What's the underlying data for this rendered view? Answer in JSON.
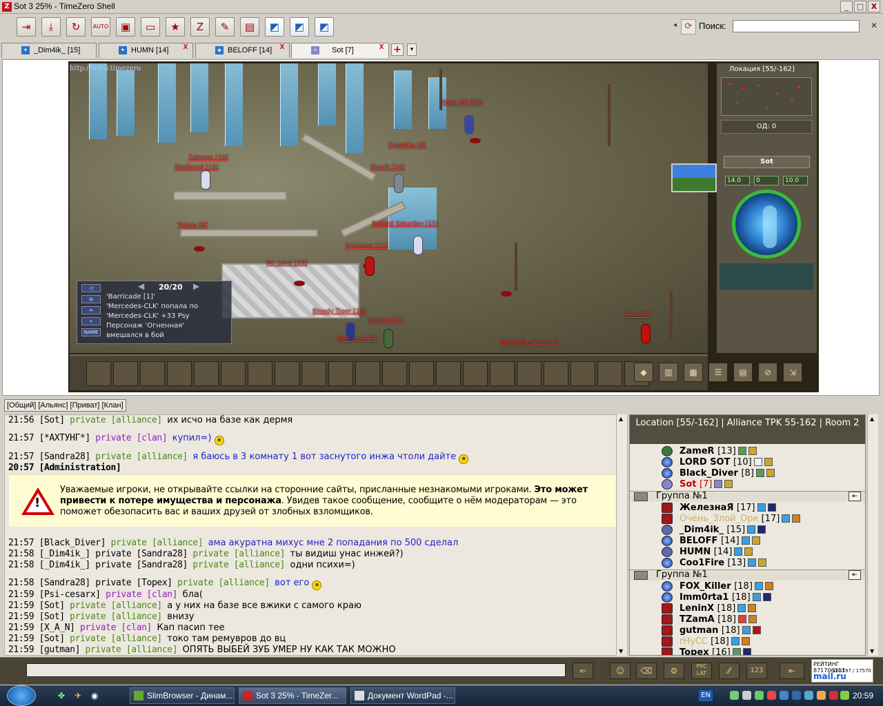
{
  "window": {
    "title": "Sot 3 25% - TimeZero Shell",
    "minimize": "_",
    "maximize": "□",
    "close": "X"
  },
  "toolbar": {
    "search_label": "Поиск:",
    "search_value": ""
  },
  "tabs": [
    {
      "label": "_Dim4ik_ [15]"
    },
    {
      "label": "HUMN [14]"
    },
    {
      "label": "BELOFF [14]"
    },
    {
      "label": "Sot [7]"
    }
  ],
  "tab_close": "X",
  "tab_add": "+",
  "tab_menu": "▾",
  "game": {
    "url": "http://www.timezero",
    "units": [
      "Main UN [10]",
      "Zahmos [10]",
      "Slodlorad [10]",
      "Dyashka [8]",
      "Sharik [10]",
      "Ballard Saturday [15]",
      "Dyrindos [12]",
      "Mr. Lone [15]",
      "Bloody Tiger [13]",
      "Tobias [8]",
      "SVP ccc [17]",
      "Magnolia [15] [15]",
      "Pixar [9]",
      "Tumka [12]"
    ],
    "event_counter": "20/20",
    "events": [
      "'Barricade [1]'",
      "'Mercedes-CLK' попала по",
      "'Mercedes-CLK' +33 Psy",
      "Персонаж 'Огненная'",
      "вмешался в бой"
    ],
    "location_title": "Локация [55/-162]",
    "od": "ОД: 0",
    "char_name": "Sot",
    "stats": [
      "14.0",
      "0",
      "10.0"
    ]
  },
  "chat": {
    "tabs_label": "[Общий] [Альянс] [Приват] [Клан]",
    "messages": [
      {
        "time": "21:56",
        "who": "[Sot]",
        "channel": "private [alliance]",
        "text": "их исчо на базе как дермя"
      },
      {
        "time": "21:57",
        "who": "[*АХТУНГ*]",
        "channel": "private [clan]",
        "text": "купил=)"
      },
      {
        "time": "21:57",
        "who": "[Sandra28]",
        "channel": "private [alliance]",
        "text": "я баюсь в 3 комнату 1 вот заснутого инжа чтоли дайте"
      },
      {
        "time": "20:57",
        "who": "[Administration]",
        "channel": "",
        "text": ""
      },
      {
        "time": "21:57",
        "who": "[Black_Diver]",
        "channel": "private [alliance]",
        "text": "ама акуратна михус мне 2 попадания по 500 сделал"
      },
      {
        "time": "21:58",
        "who": "[_Dim4ik_] private [Sandra28]",
        "channel": "private [alliance]",
        "text": "ты видиш унас инжей?)"
      },
      {
        "time": "21:58",
        "who": "[_Dim4ik_] private [Sandra28]",
        "channel": "private [alliance]",
        "text": "одни психи=)"
      },
      {
        "time": "21:58",
        "who": "[Sandra28] private [Topex]",
        "channel": "private [alliance]",
        "text": "вот его"
      },
      {
        "time": "21:59",
        "who": "[Psi-cesarx]",
        "channel": "private [clan]",
        "text": "бла("
      },
      {
        "time": "21:59",
        "who": "[Sot]",
        "channel": "private [alliance]",
        "text": "а у них на базе все вжики с самого краю"
      },
      {
        "time": "21:59",
        "who": "[Sot]",
        "channel": "private [alliance]",
        "text": "внизу"
      },
      {
        "time": "21:59",
        "who": "[X_A_N]",
        "channel": "private [clan]",
        "text": "Кап пасип тее"
      },
      {
        "time": "21:59",
        "who": "[Sot]",
        "channel": "private [alliance]",
        "text": "токо там ремувров до вц"
      },
      {
        "time": "21:59",
        "who": "[gutman]",
        "channel": "private [alliance]",
        "text": "ОПЯТЬ ВЫБЕЙ ЗУБ УМЕР НУ КАК ТАК МОЖНО"
      }
    ],
    "warning_normal_1": "Уважаемые игроки, не открывайте ссылки на сторонние сайты, присланные незнакомыми игроками. ",
    "warning_bold": "Это может привести к потере имущества и персонажа",
    "warning_normal_2": ". Увидев такое сообщение, сообщите о нём модераторам — это поможет обезопасить вас и ваших друзей от злобных взломщиков."
  },
  "roster": {
    "header": "Location [55/-162] | Alliance TPK 55-162 | Room 2",
    "group_label": "Группа №1",
    "players_top": [
      {
        "name": "ZameR",
        "level": "[13]"
      },
      {
        "name": "LORD SOT",
        "level": "[10]"
      },
      {
        "name": "Black_Diver",
        "level": "[8]"
      },
      {
        "name": "Sot",
        "level": "[7]"
      }
    ],
    "group1": [
      {
        "name": "ЖелезнаЯ",
        "level": "[17]"
      },
      {
        "name": "Очень_Злой_Орк",
        "level": "[17]"
      },
      {
        "name": "_Dim4ik_",
        "level": "[15]"
      },
      {
        "name": "BELOFF",
        "level": "[14]"
      },
      {
        "name": "HUMN",
        "level": "[14]"
      },
      {
        "name": "Coo1Fire",
        "level": "[13]"
      }
    ],
    "group2": [
      {
        "name": "FOX_Killer",
        "level": "[18]"
      },
      {
        "name": "Imm0rta1",
        "level": "[18]"
      },
      {
        "name": "LeninX",
        "level": "[18]"
      },
      {
        "name": "TZamA",
        "level": "[18]"
      },
      {
        "name": "gutman",
        "level": "[18]"
      },
      {
        "name": "rHyCC",
        "level": "[18]"
      },
      {
        "name": "Topex",
        "level": "[16]"
      }
    ]
  },
  "inputbar": {
    "rating_label": "РЕЙТИНГ",
    "rating_value": "871706113",
    "rating_counts": "185197 / 17570",
    "brand": "mail.ru",
    "lat_label": "РУС LAT"
  },
  "taskbar": {
    "tasks": [
      "SlimBrowser - Динам...",
      "Sot 3 25% - TimeZer...",
      "Документ WordPad -..."
    ],
    "lang": "EN",
    "clock": "20:59"
  },
  "colors": {
    "alliance_channel": "#4a8a1a",
    "clan_channel": "#9a1cc2",
    "chat_text_blue": "#2222c6",
    "warning_red": "#d10000",
    "unit_name_red": "#ff3030"
  }
}
